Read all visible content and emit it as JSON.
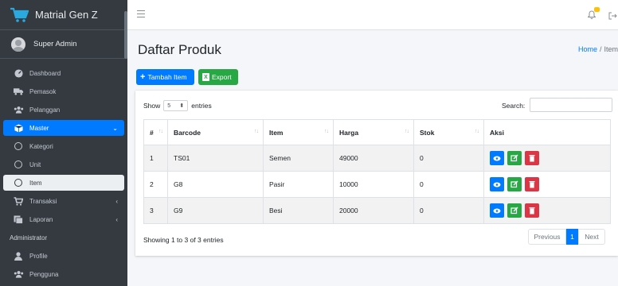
{
  "brand": {
    "name": "Matrial Gen Z"
  },
  "user": {
    "name": "Super Admin"
  },
  "sidebar": {
    "items": [
      {
        "label": "Dashboard"
      },
      {
        "label": "Pemasok"
      },
      {
        "label": "Pelanggan"
      },
      {
        "label": "Master",
        "arrow": "⌄"
      },
      {
        "label": "Kategori"
      },
      {
        "label": "Unit"
      },
      {
        "label": "Item"
      },
      {
        "label": "Transaksi",
        "arrow": "‹"
      },
      {
        "label": "Laporan",
        "arrow": "‹"
      }
    ],
    "header": "Administrator",
    "admin_items": [
      {
        "label": "Profile"
      },
      {
        "label": "Pengguna"
      }
    ]
  },
  "page": {
    "title": "Daftar Produk",
    "breadcrumb": {
      "home": "Home",
      "sep": "/",
      "current": "Item"
    }
  },
  "toolbar": {
    "add_label": "Tambah Item",
    "export_label": "Export"
  },
  "table_controls": {
    "show_label": "Show",
    "entries_value": "5",
    "entries_label": "entries",
    "search_label": "Search:",
    "search_value": ""
  },
  "table": {
    "headers": [
      "#",
      "Barcode",
      "Item",
      "Harga",
      "Stok",
      "Aksi"
    ],
    "rows": [
      {
        "no": "1",
        "barcode": "TS01",
        "item": "Semen",
        "harga": "49000",
        "stok": "0"
      },
      {
        "no": "2",
        "barcode": "G8",
        "item": "Pasir",
        "harga": "10000",
        "stok": "0"
      },
      {
        "no": "3",
        "barcode": "G9",
        "item": "Besi",
        "harga": "20000",
        "stok": "0"
      }
    ]
  },
  "footer": {
    "info": "Showing 1 to 3 of 3 entries",
    "prev": "Previous",
    "page": "1",
    "next": "Next"
  },
  "colors": {
    "primary": "#007bff",
    "success": "#28a745",
    "danger": "#dc3545",
    "sidebar": "#343a40",
    "badge": "#ffc107"
  }
}
